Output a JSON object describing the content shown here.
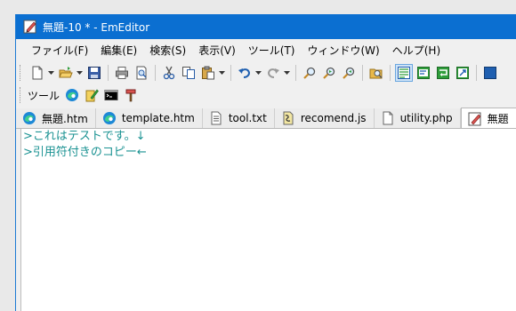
{
  "window": {
    "title": "無題-10 * - EmEditor"
  },
  "menu": [
    "ファイル(F)",
    "編集(E)",
    "検索(S)",
    "表示(V)",
    "ツール(T)",
    "ウィンドウ(W)",
    "ヘルプ(H)"
  ],
  "toolbar2": {
    "label": "ツール"
  },
  "tabs": [
    {
      "label": "無題.htm",
      "icon": "edge-icon"
    },
    {
      "label": "template.htm",
      "icon": "edge-icon"
    },
    {
      "label": "tool.txt",
      "icon": "text-file-icon"
    },
    {
      "label": "recomend.js",
      "icon": "js-file-icon"
    },
    {
      "label": "utility.php",
      "icon": "blank-file-icon"
    },
    {
      "label": "無題",
      "icon": "emeditor-icon",
      "active": true
    }
  ],
  "editor": {
    "lines": [
      {
        "text": ">これはテストです。",
        "end_mark": "↓"
      },
      {
        "text": ">引用符付きのコピー",
        "end_mark": "←"
      }
    ],
    "text_color": "#1a9292"
  },
  "colors": {
    "titlebar": "#0b6fd1",
    "accent": "#1c7ad4"
  }
}
